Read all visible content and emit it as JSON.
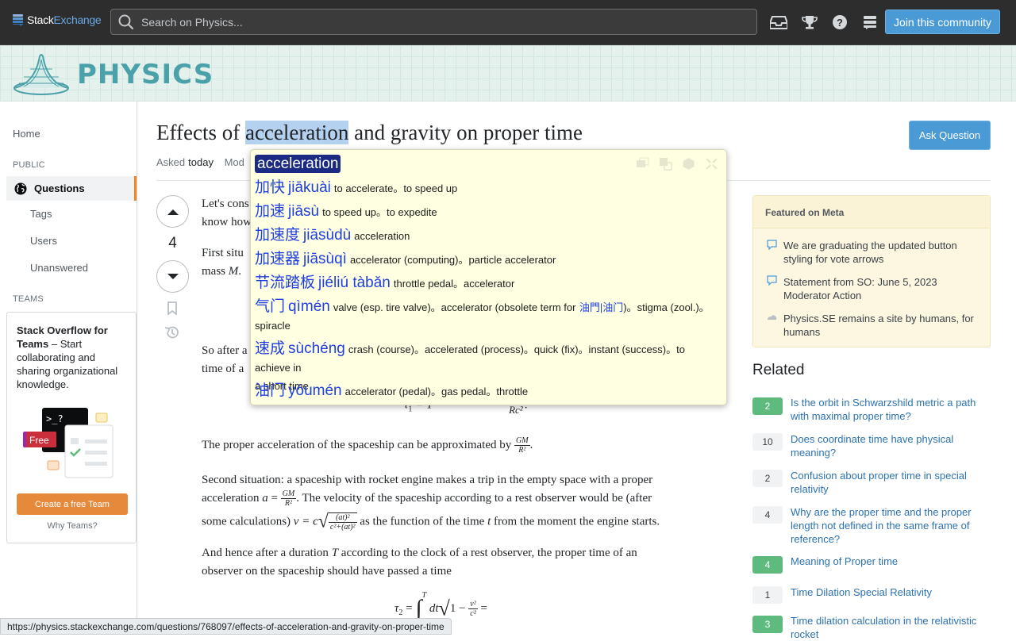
{
  "topbar": {
    "logo_text_white": "Stack",
    "logo_text_blue": "Exchange",
    "search_placeholder": "Search on Physics...",
    "join_label": "Join this community",
    "icons": [
      "inbox-icon",
      "trophy-icon",
      "help-icon",
      "site-switcher-icon"
    ]
  },
  "site": {
    "name": "PHYSICS"
  },
  "leftnav": {
    "home": "Home",
    "public_label": "PUBLIC",
    "questions": "Questions",
    "tags": "Tags",
    "users": "Users",
    "unanswered": "Unanswered",
    "teams_label": "TEAMS",
    "teams_title_bold": "Stack Overflow for Teams",
    "teams_title_rest": " – Start collaborating and sharing organizational knowledge.",
    "teams_free_badge": "Free",
    "teams_button": "Create a free Team",
    "teams_why": "Why Teams?"
  },
  "question": {
    "title_before": "Effects of ",
    "title_selected": "acceleration",
    "title_after": " and gravity on proper time",
    "asked_label": "Asked",
    "asked_value": "today",
    "modified_label": "Mod",
    "ask_button": "Ask Question",
    "vote_count": "4",
    "body": {
      "p1a": "Let's cons",
      "p1b": "know how",
      "p2a": "First situ",
      "p2b": "mass",
      "p2_var": "M",
      "p3a": "So after a",
      "p3b": "time of a",
      "eq1_lhs": "τ",
      "eq1_sub": "1",
      "eq1_rhs": "= T",
      "eq1_frac_den": "Rc²",
      "p4": "The proper acceleration of the spaceship can be approximated by",
      "gm": "GM",
      "r2": "R²",
      "p5a": "Second situation: a spaceship with rocket engine makes a trip in the empty space with a proper",
      "p5b_1": "acceleration",
      "p5b_var": "a",
      "p5b_2": ". The velocity of the spaceship according to a rest observer would be (after",
      "p5c_1": "some calculations)",
      "p5c_var": "v = c",
      "p5c_num": "(at)²",
      "p5c_den": "c²+(at)²",
      "p5c_2": "as the function of the time",
      "p5c_t": "t",
      "p5c_3": "from the moment the engine starts.",
      "p6a_1": "And hence after a duration",
      "p6a_T": "T",
      "p6a_2": "according to the clock of a rest observer, the proper time of an",
      "p6b": "observer on the spaceship should have passed a time",
      "eq2_lhs": "τ",
      "eq2_sub": "2",
      "eq2_int_upper": "T",
      "eq2_dt": "dt",
      "eq2_num": "v²",
      "eq2_den": "c²"
    }
  },
  "featured": {
    "heading": "Featured on Meta",
    "items": [
      "We are graduating the updated button styling for vote arrows",
      "Statement from SO: June 5, 2023 Moderator Action",
      "Physics.SE remains a site by humans, for humans"
    ]
  },
  "related": {
    "heading": "Related",
    "items": [
      {
        "score": "2",
        "answered": true,
        "title": "Is the orbit in Schwarzshild metric a path with maximal proper time?"
      },
      {
        "score": "10",
        "answered": false,
        "title": "Does coordinate time have physical meaning?"
      },
      {
        "score": "2",
        "answered": false,
        "title": "Confusion about proper time in special relativity"
      },
      {
        "score": "4",
        "answered": false,
        "title": "Why are the proper time and the proper length not defined in the same frame of reference?"
      },
      {
        "score": "4",
        "answered": true,
        "title": "Meaning of Proper time"
      },
      {
        "score": "1",
        "answered": false,
        "title": "Time Dilation Special Relativity"
      },
      {
        "score": "3",
        "answered": true,
        "title": "Time dilation calculation in the relativistic rocket"
      }
    ]
  },
  "statusbar": {
    "url": "https://physics.stackexchange.com/questions/768097/effects-of-acceleration-and-gravity-on-proper-time"
  },
  "popup": {
    "word": "acceleration",
    "entries": [
      {
        "hanzi": "加快",
        "pinyin": "jiākuài",
        "def": "to accelerate。to speed up"
      },
      {
        "hanzi": "加速",
        "pinyin": "jiāsù",
        "def": "to speed up。to expedite"
      },
      {
        "hanzi": "加速度",
        "pinyin": "jiāsùdù",
        "def": "acceleration"
      },
      {
        "hanzi": "加速器",
        "pinyin": "jiāsùqì",
        "def": "accelerator (computing)。particle accelerator"
      },
      {
        "hanzi": "节流踏板",
        "pinyin": "jiéliú tàbǎn",
        "def": "throttle pedal。accelerator"
      },
      {
        "hanzi": "气门",
        "pinyin": "qìmén",
        "def_a": "valve (esp. tire valve)。accelerator (obsolete term for",
        "def_link": "油門|油门",
        "def_b": ")。stigma (zool.)。",
        "def_c": "spiracle"
      },
      {
        "hanzi": "速成",
        "pinyin": "sùchéng",
        "def": "crash (course)。accelerated (process)。quick (fix)。instant (success)。to achieve in",
        "def_c": "a short time"
      },
      {
        "hanzi": "油门",
        "pinyin": "yóumén",
        "def": "accelerator (pedal)。gas pedal。throttle"
      }
    ]
  }
}
